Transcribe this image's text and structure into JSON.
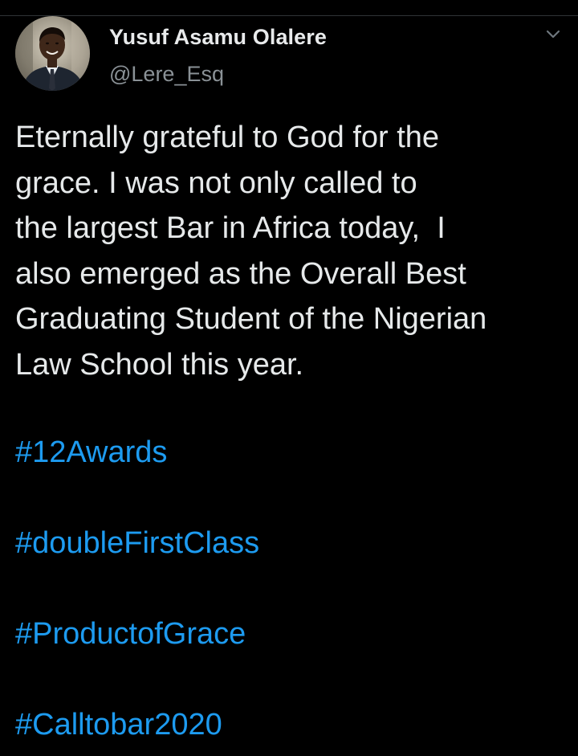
{
  "author": {
    "display_name": "Yusuf Asamu Olalere",
    "handle": "@Lere_Esq",
    "avatar_icon": "user-avatar-photo"
  },
  "menu": {
    "icon": "chevron-down-icon"
  },
  "tweet": {
    "lines": [
      "Eternally grateful to God for the",
      "grace. I was not only called to",
      "the largest Bar in Africa today,  I",
      "also emerged as the Overall Best",
      "Graduating Student of the Nigerian",
      "Law School this year."
    ],
    "hashtags": [
      "#12Awards",
      "#doubleFirstClass",
      "#ProductofGrace",
      "#Calltobar2020"
    ]
  },
  "colors": {
    "background": "#000000",
    "text": "#e6e9ea",
    "muted": "#8a9196",
    "link": "#1d9bf0"
  }
}
